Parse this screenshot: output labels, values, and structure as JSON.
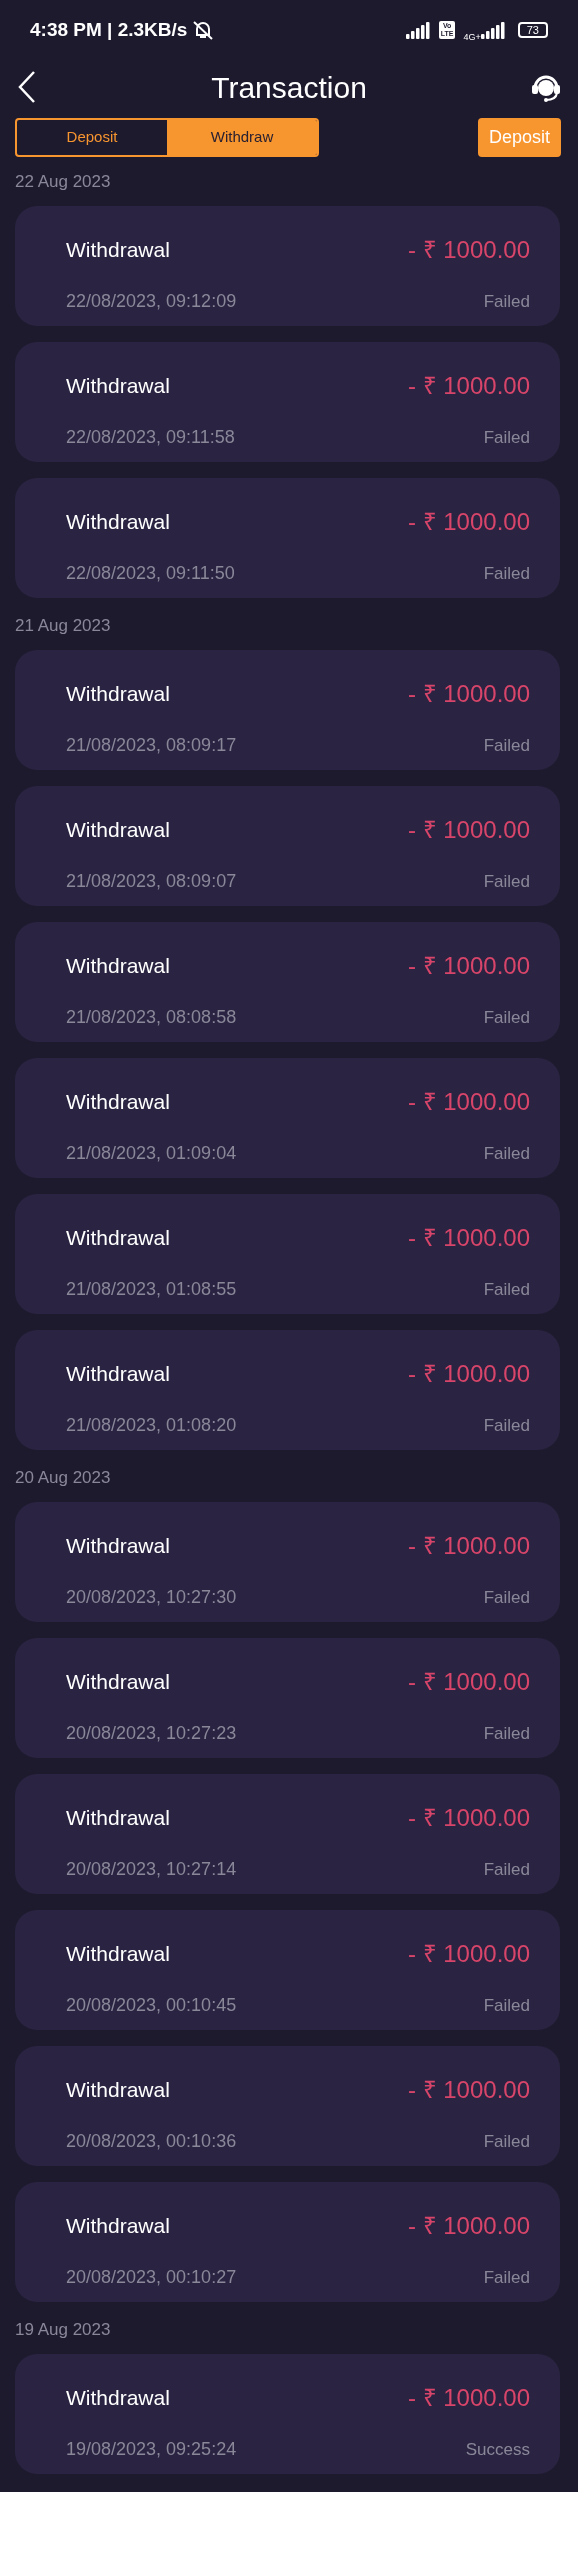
{
  "status_bar": {
    "time": "4:38 PM | 2.3KB/s",
    "volte_top": "Vo",
    "volte_bottom": "LTE",
    "network": "4G+",
    "battery": "73"
  },
  "header": {
    "title": "Transaction"
  },
  "tabs": [
    {
      "label": "Deposit",
      "selected": false
    },
    {
      "label": "Withdraw",
      "selected": true
    }
  ],
  "deposit_button": "Deposit",
  "groups": [
    {
      "date": "22 Aug 2023",
      "transactions": [
        {
          "title": "Withdrawal",
          "amount": "- ₹ 1000.00",
          "datetime": "22/08/2023, 09:12:09",
          "status": "Failed"
        },
        {
          "title": "Withdrawal",
          "amount": "- ₹ 1000.00",
          "datetime": "22/08/2023, 09:11:58",
          "status": "Failed"
        },
        {
          "title": "Withdrawal",
          "amount": "- ₹ 1000.00",
          "datetime": "22/08/2023, 09:11:50",
          "status": "Failed"
        }
      ]
    },
    {
      "date": "21 Aug 2023",
      "transactions": [
        {
          "title": "Withdrawal",
          "amount": "- ₹ 1000.00",
          "datetime": "21/08/2023, 08:09:17",
          "status": "Failed"
        },
        {
          "title": "Withdrawal",
          "amount": "- ₹ 1000.00",
          "datetime": "21/08/2023, 08:09:07",
          "status": "Failed"
        },
        {
          "title": "Withdrawal",
          "amount": "- ₹ 1000.00",
          "datetime": "21/08/2023, 08:08:58",
          "status": "Failed"
        },
        {
          "title": "Withdrawal",
          "amount": "- ₹ 1000.00",
          "datetime": "21/08/2023, 01:09:04",
          "status": "Failed"
        },
        {
          "title": "Withdrawal",
          "amount": "- ₹ 1000.00",
          "datetime": "21/08/2023, 01:08:55",
          "status": "Failed"
        },
        {
          "title": "Withdrawal",
          "amount": "- ₹ 1000.00",
          "datetime": "21/08/2023, 01:08:20",
          "status": "Failed"
        }
      ]
    },
    {
      "date": "20 Aug 2023",
      "transactions": [
        {
          "title": "Withdrawal",
          "amount": "- ₹ 1000.00",
          "datetime": "20/08/2023, 10:27:30",
          "status": "Failed"
        },
        {
          "title": "Withdrawal",
          "amount": "- ₹ 1000.00",
          "datetime": "20/08/2023, 10:27:23",
          "status": "Failed"
        },
        {
          "title": "Withdrawal",
          "amount": "- ₹ 1000.00",
          "datetime": "20/08/2023, 10:27:14",
          "status": "Failed"
        },
        {
          "title": "Withdrawal",
          "amount": "- ₹ 1000.00",
          "datetime": "20/08/2023, 00:10:45",
          "status": "Failed"
        },
        {
          "title": "Withdrawal",
          "amount": "- ₹ 1000.00",
          "datetime": "20/08/2023, 00:10:36",
          "status": "Failed"
        },
        {
          "title": "Withdrawal",
          "amount": "- ₹ 1000.00",
          "datetime": "20/08/2023, 00:10:27",
          "status": "Failed"
        }
      ]
    },
    {
      "date": "19 Aug 2023",
      "transactions": [
        {
          "title": "Withdrawal",
          "amount": "- ₹ 1000.00",
          "datetime": "19/08/2023, 09:25:24",
          "status": "Success"
        }
      ]
    }
  ]
}
